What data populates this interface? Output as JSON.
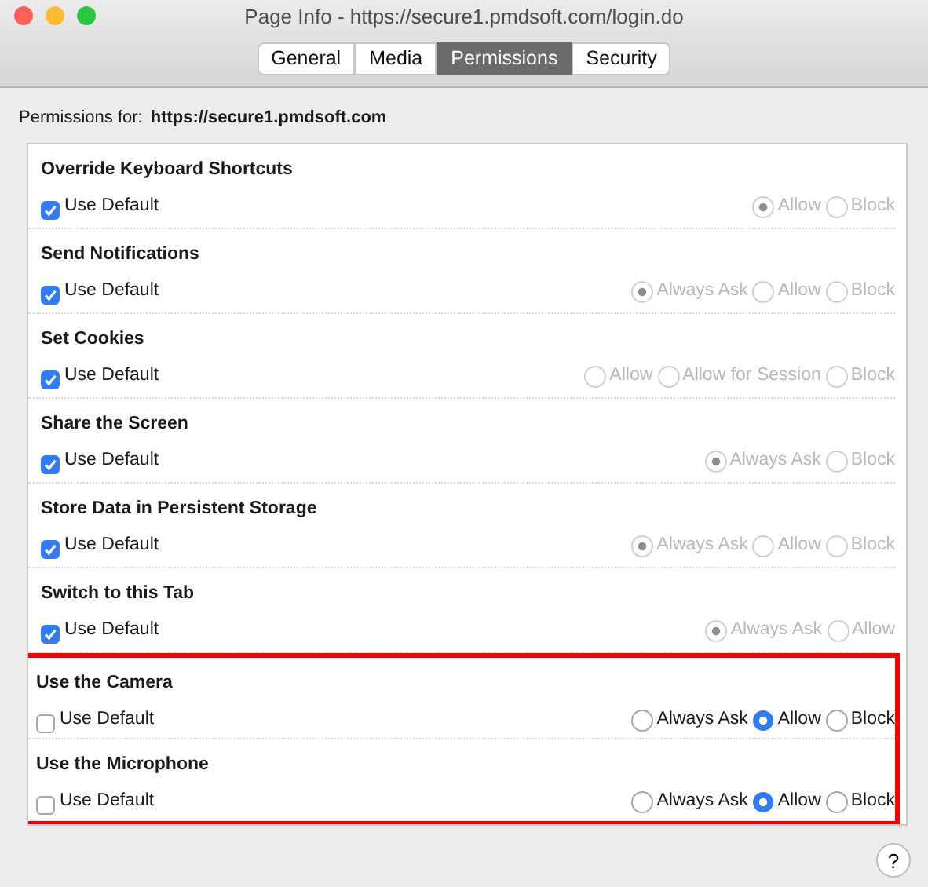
{
  "window": {
    "title": "Page Info - https://secure1.pmdsoft.com/login.do"
  },
  "tabs": [
    {
      "label": "General",
      "selected": false
    },
    {
      "label": "Media",
      "selected": false
    },
    {
      "label": "Permissions",
      "selected": true
    },
    {
      "label": "Security",
      "selected": false
    }
  ],
  "permissions_for": {
    "label": "Permissions for:",
    "site": "https://secure1.pmdsoft.com"
  },
  "permissions": [
    {
      "title": "Override Keyboard Shortcuts",
      "use_default_label": "Use Default",
      "use_default": true,
      "highlighted": false,
      "options": [
        {
          "label": "Allow",
          "selected": true
        },
        {
          "label": "Block",
          "selected": false
        }
      ]
    },
    {
      "title": "Send Notifications",
      "use_default_label": "Use Default",
      "use_default": true,
      "highlighted": false,
      "options": [
        {
          "label": "Always Ask",
          "selected": true
        },
        {
          "label": "Allow",
          "selected": false
        },
        {
          "label": "Block",
          "selected": false
        }
      ]
    },
    {
      "title": "Set Cookies",
      "use_default_label": "Use Default",
      "use_default": true,
      "highlighted": false,
      "options": [
        {
          "label": "Allow",
          "selected": false
        },
        {
          "label": "Allow for Session",
          "selected": false
        },
        {
          "label": "Block",
          "selected": false
        }
      ]
    },
    {
      "title": "Share the Screen",
      "use_default_label": "Use Default",
      "use_default": true,
      "highlighted": false,
      "options": [
        {
          "label": "Always Ask",
          "selected": true
        },
        {
          "label": "Block",
          "selected": false
        }
      ]
    },
    {
      "title": "Store Data in Persistent Storage",
      "use_default_label": "Use Default",
      "use_default": true,
      "highlighted": false,
      "options": [
        {
          "label": "Always Ask",
          "selected": true
        },
        {
          "label": "Allow",
          "selected": false
        },
        {
          "label": "Block",
          "selected": false
        }
      ]
    },
    {
      "title": "Switch to this Tab",
      "use_default_label": "Use Default",
      "use_default": true,
      "highlighted": false,
      "options": [
        {
          "label": "Always Ask",
          "selected": true
        },
        {
          "label": "Allow",
          "selected": false
        }
      ]
    },
    {
      "title": "Use the Camera",
      "use_default_label": "Use Default",
      "use_default": false,
      "highlighted": true,
      "options": [
        {
          "label": "Always Ask",
          "selected": false
        },
        {
          "label": "Allow",
          "selected": true
        },
        {
          "label": "Block",
          "selected": false
        }
      ]
    },
    {
      "title": "Use the Microphone",
      "use_default_label": "Use Default",
      "use_default": false,
      "highlighted": true,
      "options": [
        {
          "label": "Always Ask",
          "selected": false
        },
        {
          "label": "Allow",
          "selected": true
        },
        {
          "label": "Block",
          "selected": false
        }
      ]
    }
  ],
  "help_button": {
    "label": "?"
  }
}
